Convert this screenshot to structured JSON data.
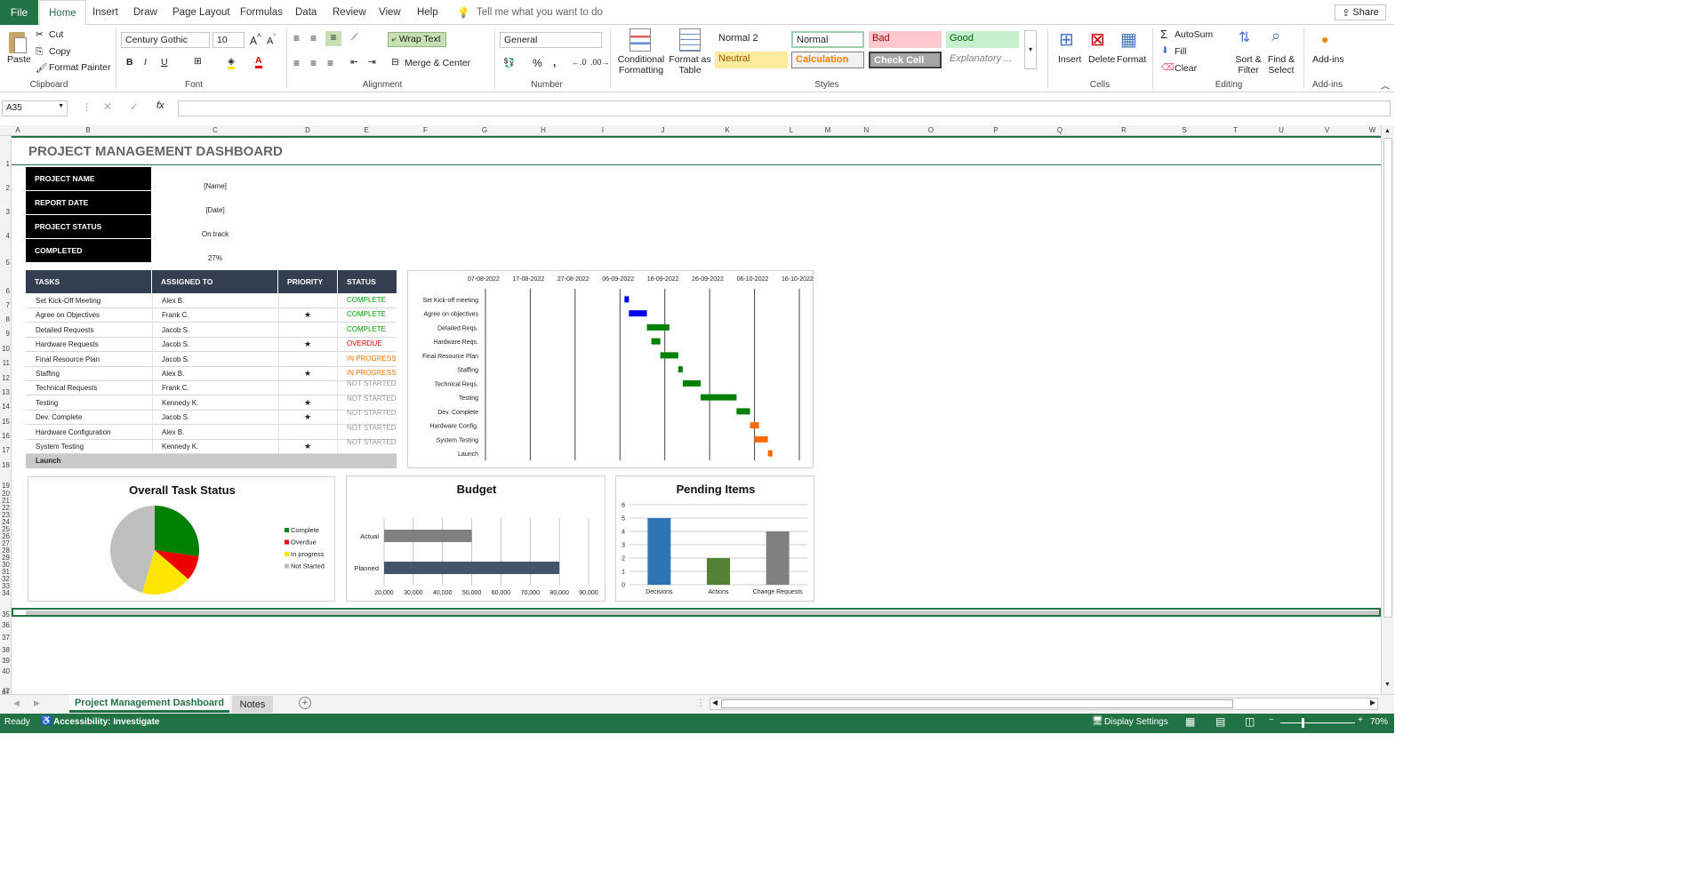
{
  "menu": {
    "file": "File",
    "tabs": [
      "Home",
      "Insert",
      "Draw",
      "Page Layout",
      "Formulas",
      "Data",
      "Review",
      "View",
      "Help"
    ],
    "tell_me": "Tell me what you want to do",
    "share": "Share"
  },
  "ribbon": {
    "clipboard": {
      "paste": "Paste",
      "cut": "Cut",
      "copy": "Copy",
      "format_painter": "Format Painter",
      "label": "Clipboard"
    },
    "font": {
      "name": "Century Gothic",
      "size": "10",
      "bold": "B",
      "italic": "I",
      "underline": "U",
      "label": "Font"
    },
    "alignment": {
      "wrap_text": "Wrap Text",
      "merge_center": "Merge & Center",
      "label": "Alignment"
    },
    "number": {
      "format": "General",
      "percent": "%",
      "comma": ",",
      "label": "Number"
    },
    "styles": {
      "conditional_formatting": "Conditional Formatting",
      "format_as_table": "Format as Table",
      "cells": [
        "Normal 2",
        "Normal",
        "Bad",
        "Good",
        "Neutral",
        "Calculation",
        "Check Cell",
        "Explanatory ..."
      ],
      "label": "Styles"
    },
    "cells": {
      "insert": "Insert",
      "delete": "Delete",
      "format": "Format",
      "label": "Cells"
    },
    "editing": {
      "autosum": "AutoSum",
      "fill": "Fill",
      "clear": "Clear",
      "sort_filter": "Sort & Filter",
      "find_select": "Find & Select",
      "label": "Editing"
    },
    "addins": {
      "addins": "Add-ins",
      "label": "Add-ins"
    }
  },
  "formula_bar": {
    "name_box": "A35",
    "fx": "fx",
    "formula": ""
  },
  "columns": [
    "A",
    "B",
    "C",
    "D",
    "E",
    "F",
    "G",
    "H",
    "I",
    "J",
    "K",
    "L",
    "M",
    "N",
    "O",
    "P",
    "Q",
    "R",
    "S",
    "T",
    "U",
    "V",
    "W"
  ],
  "rows": [
    "1",
    "2",
    "3",
    "4",
    "5",
    "6",
    "7",
    "8",
    "9",
    "10",
    "11",
    "12",
    "13",
    "14",
    "15",
    "16",
    "17",
    "18",
    "19",
    "20",
    "21",
    "22",
    "23",
    "24",
    "25",
    "26",
    "27",
    "28",
    "29",
    "30",
    "31",
    "32",
    "33",
    "34",
    "35",
    "36",
    "37",
    "38",
    "39",
    "40",
    "41",
    "42"
  ],
  "dashboard": {
    "title": "PROJECT MANAGEMENT DASHBOARD",
    "info": [
      {
        "label": "PROJECT NAME",
        "value": "[Name]"
      },
      {
        "label": "REPORT DATE",
        "value": "[Date]"
      },
      {
        "label": "PROJECT STATUS",
        "value": "On track"
      },
      {
        "label": "COMPLETED",
        "value": "27%"
      }
    ],
    "task_headers": [
      "TASKS",
      "ASSIGNED TO",
      "PRIORITY",
      "STATUS"
    ],
    "tasks": [
      {
        "task": "Set Kick-Off Meeting",
        "assigned": "Alex B.",
        "priority": "",
        "status": "COMPLETE",
        "color": "#00a000"
      },
      {
        "task": "Agree on Objectives",
        "assigned": "Frank C.",
        "priority": "★",
        "status": "COMPLETE",
        "color": "#00a000"
      },
      {
        "task": "Detailed Requests",
        "assigned": "Jacob S.",
        "priority": "",
        "status": "COMPLETE",
        "color": "#00a000"
      },
      {
        "task": "Hardware Requests",
        "assigned": "Jacob S.",
        "priority": "★",
        "status": "OVERDUE",
        "color": "#e00000"
      },
      {
        "task": "Final Resource Plan",
        "assigned": "Jacob S.",
        "priority": "",
        "status": "IN PROGRESS",
        "color": "#f07800"
      },
      {
        "task": "Staffing",
        "assigned": "Alex B.",
        "priority": "★",
        "status": "IN PROGRESS",
        "color": "#f07800"
      },
      {
        "task": "Technical Requests",
        "assigned": "Frank C.",
        "priority": "",
        "status": "NOT STARTED",
        "color": "#999999"
      },
      {
        "task": "Testing",
        "assigned": "Kennedy K.",
        "priority": "★",
        "status": "NOT STARTED",
        "color": "#999999"
      },
      {
        "task": "Dev. Complete",
        "assigned": "Jacob S.",
        "priority": "★",
        "status": "NOT STARTED",
        "color": "#999999"
      },
      {
        "task": "Hardware Configuration",
        "assigned": "Alex B.",
        "priority": "",
        "status": "NOT STARTED",
        "color": "#999999"
      },
      {
        "task": "System Testing",
        "assigned": "Kennedy K.",
        "priority": "★",
        "status": "NOT STARTED",
        "color": "#999999"
      }
    ],
    "launch_row": "Launch"
  },
  "chart_data": [
    {
      "type": "bar",
      "subtype": "gantt",
      "title": "",
      "x_ticks": [
        "07-08-2022",
        "17-08-2022",
        "27-08-2022",
        "06-09-2022",
        "16-09-2022",
        "26-09-2022",
        "06-10-2022",
        "16-10-2022"
      ],
      "x_range_days": [
        0,
        70
      ],
      "tasks": [
        {
          "name": "Set Kick-off meeting",
          "start": 31,
          "duration": 1,
          "color": "#0000ee"
        },
        {
          "name": "Agree on objectives",
          "start": 32,
          "duration": 4,
          "color": "#0000ee"
        },
        {
          "name": "Detailed Reqs.",
          "start": 36,
          "duration": 5,
          "color": "#008000"
        },
        {
          "name": "Hardware Reqs.",
          "start": 37,
          "duration": 2,
          "color": "#008000"
        },
        {
          "name": "Final Resource Plan",
          "start": 39,
          "duration": 4,
          "color": "#008000"
        },
        {
          "name": "Staffing",
          "start": 43,
          "duration": 1,
          "color": "#008000"
        },
        {
          "name": "Technical Reqs.",
          "start": 44,
          "duration": 4,
          "color": "#008000"
        },
        {
          "name": "Testing",
          "start": 48,
          "duration": 8,
          "color": "#008000"
        },
        {
          "name": "Dev. Complete",
          "start": 56,
          "duration": 3,
          "color": "#008000"
        },
        {
          "name": "Hardware Config.",
          "start": 59,
          "duration": 2,
          "color": "#ff6a00"
        },
        {
          "name": "System Testing",
          "start": 60,
          "duration": 3,
          "color": "#ff6a00"
        },
        {
          "name": "Launch",
          "start": 63,
          "duration": 1,
          "color": "#ff6a00"
        }
      ]
    },
    {
      "type": "pie",
      "title": "Overall Task Status",
      "labels": [
        "Complete",
        "Overdue",
        "In progress",
        "Not Started"
      ],
      "values": [
        3,
        1,
        2,
        5
      ],
      "colors": [
        "#008000",
        "#ee0000",
        "#ffe600",
        "#bfbfbf"
      ],
      "legend": "right"
    },
    {
      "type": "bar",
      "orientation": "horizontal",
      "title": "Budget",
      "categories": [
        "Actual",
        "Planned"
      ],
      "values": [
        50000,
        80000
      ],
      "colors": [
        "#808080",
        "#44546a"
      ],
      "xlim": [
        20000,
        90000
      ],
      "x_ticks": [
        "20,000",
        "30,000",
        "40,000",
        "50,000",
        "60,000",
        "70,000",
        "80,000",
        "90,000"
      ]
    },
    {
      "type": "bar",
      "title": "Pending Items",
      "categories": [
        "Decisions",
        "Actions",
        "Change Requests"
      ],
      "values": [
        5,
        2,
        4
      ],
      "colors": [
        "#2e75b6",
        "#548235",
        "#808080"
      ],
      "ylim": [
        0,
        6
      ],
      "y_ticks": [
        "0",
        "1",
        "2",
        "3",
        "4",
        "5",
        "6"
      ]
    }
  ],
  "sheet_tabs": {
    "active": "Project Management Dashboard",
    "other": "Notes"
  },
  "status": {
    "ready": "Ready",
    "accessibility": "Accessibility: Investigate",
    "display_settings": "Display Settings",
    "zoom": "70%"
  }
}
